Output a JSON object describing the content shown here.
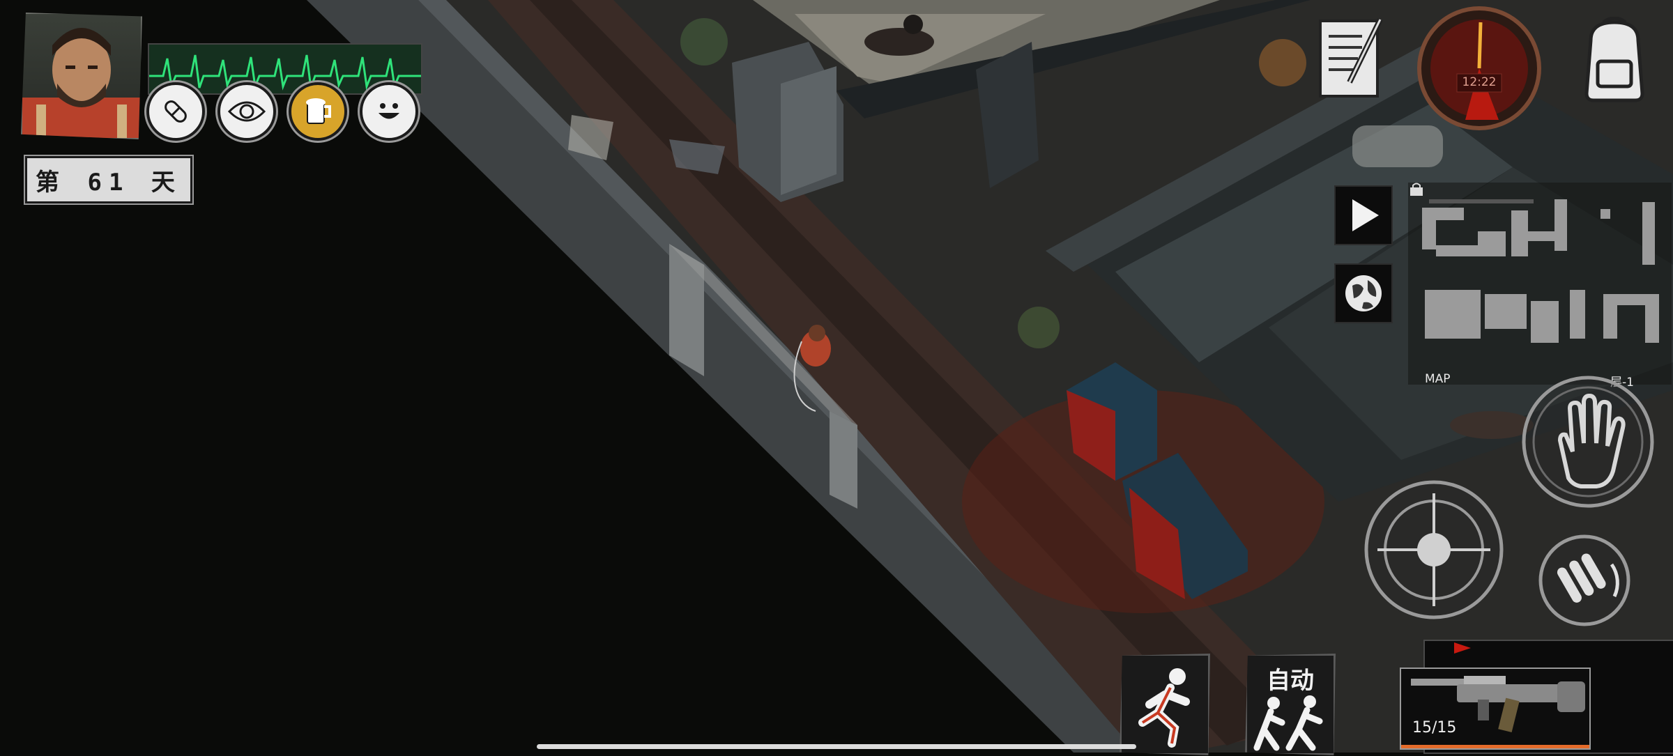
{
  "hud": {
    "day": {
      "label": "第  61  天"
    },
    "status_icons": [
      "pill-icon",
      "eye-icon",
      "beer-mug-icon",
      "smiley-face-icon"
    ],
    "colors": {
      "heartbeat": "#2fe37a",
      "status_active": "#d8a42a",
      "blood": "#b81a10",
      "ammo_bar": "#e46b2a"
    }
  },
  "clock": {
    "time": "12:22"
  },
  "minimap": {
    "label": "MAP",
    "floor": "层-1"
  },
  "buttons": {
    "journal": "journal-icon",
    "backpack": "backpack-icon",
    "play": "play-icon",
    "globe": "globe-icon",
    "interact": "hand-icon",
    "aim": "crosshair-icon",
    "reload": "ammo-reload-icon",
    "auto_label": "自动"
  },
  "weapon": {
    "ammo": "15/15",
    "ammo_fraction": 1.0
  }
}
